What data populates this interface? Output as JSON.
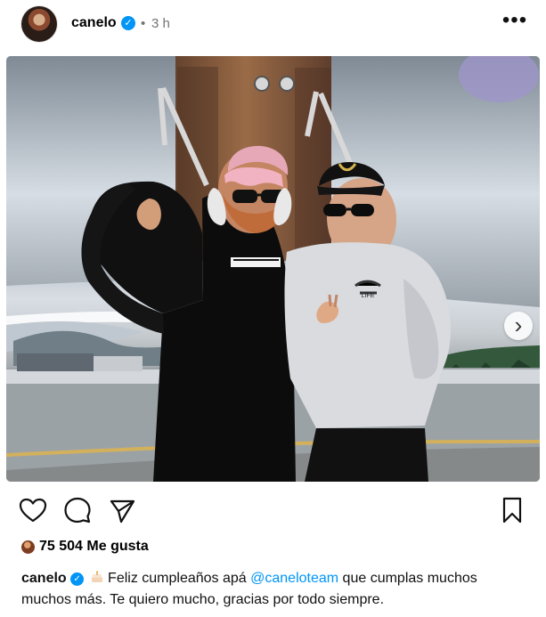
{
  "post": {
    "username": "canelo",
    "time_separator": "•",
    "time": "3 h",
    "more_icon": "more-horizontal-icon",
    "media": {
      "type": "carousel",
      "active_slide": 1,
      "slide_count": 2
    },
    "actions": {
      "like_icon": "heart-icon",
      "comment_icon": "comment-icon",
      "share_icon": "share-icon",
      "save_icon": "bookmark-icon"
    },
    "likes_count": "75 504",
    "likes_label": "Me gusta",
    "caption": {
      "username": "canelo",
      "emoji": "cake-icon",
      "text_before": "Feliz cumpleaños apá ",
      "mention": "@caneloteam",
      "text_after": " que cumplas muchos muchos más. Te quiero mucho, gracias por todo siempre."
    }
  },
  "colors": {
    "verified_blue": "#0095f6",
    "secondary_text": "#737373",
    "mention_blue": "#0095f6"
  }
}
